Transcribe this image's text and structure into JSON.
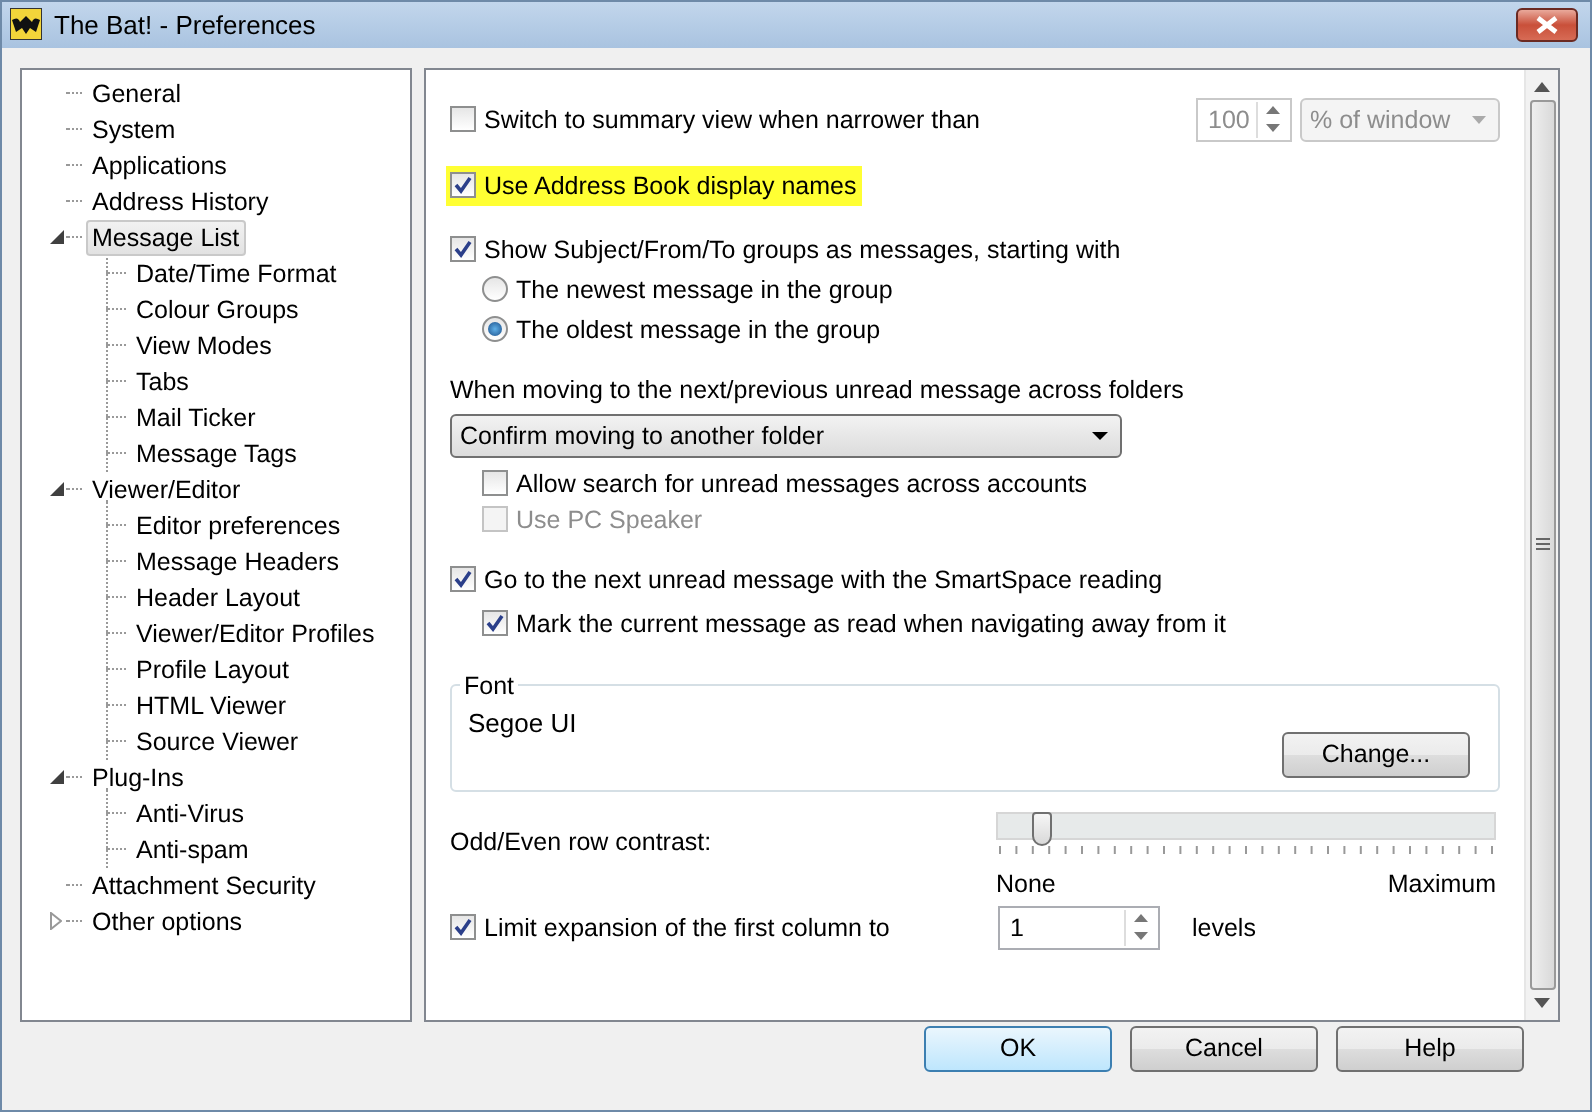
{
  "window": {
    "title": "The Bat! - Preferences"
  },
  "tree": [
    {
      "label": "General",
      "selected": false
    },
    {
      "label": "System",
      "selected": false
    },
    {
      "label": "Applications",
      "selected": false
    },
    {
      "label": "Address History",
      "selected": false
    },
    {
      "label": "Message List",
      "selected": true,
      "expanded": true,
      "children": [
        {
          "label": "Date/Time Format",
          "selected": false
        },
        {
          "label": "Colour Groups",
          "selected": false
        },
        {
          "label": "View Modes",
          "selected": false
        },
        {
          "label": "Tabs",
          "selected": false
        },
        {
          "label": "Mail Ticker",
          "selected": false
        },
        {
          "label": "Message Tags",
          "selected": false
        }
      ]
    },
    {
      "label": "Viewer/Editor",
      "selected": false,
      "expanded": true,
      "children": [
        {
          "label": "Editor preferences",
          "selected": false
        },
        {
          "label": "Message Headers",
          "selected": false
        },
        {
          "label": "Header Layout",
          "selected": false
        },
        {
          "label": "Viewer/Editor Profiles",
          "selected": false
        },
        {
          "label": "Profile Layout",
          "selected": false
        },
        {
          "label": "HTML Viewer",
          "selected": false
        },
        {
          "label": "Source Viewer",
          "selected": false
        }
      ]
    },
    {
      "label": "Plug-Ins",
      "selected": false,
      "expanded": true,
      "children": [
        {
          "label": "Anti-Virus",
          "selected": false
        },
        {
          "label": "Anti-spam",
          "selected": false
        }
      ]
    },
    {
      "label": "Attachment Security",
      "selected": false
    },
    {
      "label": "Other options",
      "selected": false,
      "expanded": false
    }
  ],
  "summary": {
    "label": "Switch to summary view when narrower than",
    "checked": false,
    "value": "100",
    "unit": "% of window"
  },
  "address_book": {
    "label": "Use Address Book display names",
    "checked": true,
    "highlighted": true
  },
  "groups": {
    "label": "Show Subject/From/To groups as messages, starting with",
    "checked": true,
    "radios": [
      {
        "label": "The newest message in the group",
        "selected": false
      },
      {
        "label": "The oldest message in the group",
        "selected": true
      }
    ]
  },
  "moving": {
    "label": "When moving to the next/previous unread message across folders",
    "dropdown": "Confirm moving to another folder",
    "options": [
      {
        "label": "Allow search for unread messages across accounts",
        "checked": false,
        "disabled": false
      },
      {
        "label": "Use PC Speaker",
        "checked": false,
        "disabled": true
      }
    ]
  },
  "smartspace": {
    "label": "Go to the next unread message with the SmartSpace reading",
    "checked": true,
    "sub": {
      "label": "Mark the current message as read when navigating away from it",
      "checked": true
    }
  },
  "font": {
    "legend": "Font",
    "name": "Segoe UI",
    "button": "Change..."
  },
  "contrast": {
    "label": "Odd/Even row contrast:",
    "level": 0.09,
    "min_label": "None",
    "max_label": "Maximum"
  },
  "limit": {
    "label": "Limit expansion of the first column to",
    "checked": true,
    "value": "1",
    "unit": "levels"
  },
  "buttons": [
    {
      "label": "OK",
      "default": true
    },
    {
      "label": "Cancel",
      "default": false
    },
    {
      "label": "Help",
      "default": false
    }
  ]
}
